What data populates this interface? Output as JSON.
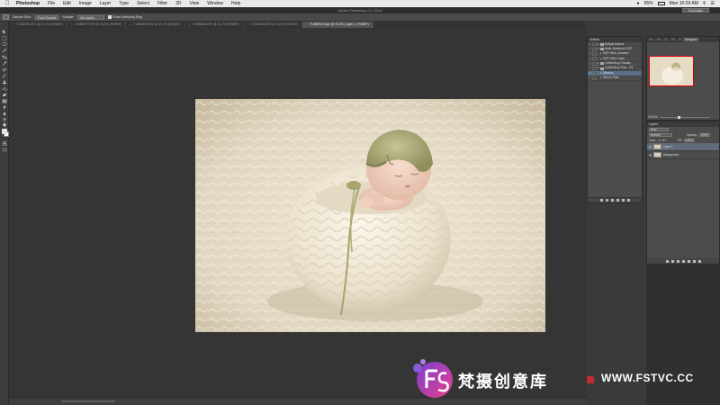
{
  "menubar": {
    "app_name": "Photoshop",
    "items": [
      "File",
      "Edit",
      "Image",
      "Layer",
      "Type",
      "Select",
      "Filter",
      "3D",
      "View",
      "Window",
      "Help"
    ],
    "battery": "95%",
    "clock": "Mon 10:29 AM"
  },
  "window": {
    "title": "Adobe Photoshop CC 2014",
    "workspace": "Essentials"
  },
  "options": {
    "sample_size_label": "Sample Size:",
    "sample_size_value": "Point Sample",
    "sample_label": "Sample:",
    "sample_value": "All Layers",
    "show_ring_label": "Show Sampling Ring"
  },
  "tabs": [
    {
      "label": "71SB0851CR2 @ 11.1% (RGB/8*)",
      "active": false
    },
    {
      "label": "71SB0877CR2 @ 33.3% (RGB/8*)",
      "active": false
    },
    {
      "label": "71SB0882CR2 @ 33.3% (RGB/8*)",
      "active": false
    },
    {
      "label": "71SB0883CR2 @ 33.3% (RGB/8*)",
      "active": false
    },
    {
      "label": "71SB0903CR2 @ 33.3% (RGB/8*)",
      "active": false
    },
    {
      "label": "71SB0910.tiwe @ 33.3% (Layer 1, RGB/8*)",
      "active": true
    }
  ],
  "actions_panel": {
    "tab": "Actions",
    "items": [
      {
        "label": "Default Actions",
        "kind": "set",
        "highlight": false
      },
      {
        "label": "Hello, Newborn! SCP",
        "kind": "set",
        "highlight": false
      },
      {
        "label": "SCP Hello, Sweeten",
        "kind": "action",
        "highlight": false
      },
      {
        "label": "SCP Hello, Haze",
        "kind": "action",
        "highlight": false
      },
      {
        "label": "CoffeeShop Powder...",
        "kind": "set",
        "highlight": false
      },
      {
        "label": "CoffeeShop Pow... S3",
        "kind": "set",
        "highlight": false
      },
      {
        "label": "Shadow",
        "kind": "action",
        "highlight": true
      },
      {
        "label": "Wet as Paint",
        "kind": "action",
        "highlight": false
      }
    ]
  },
  "navigator": {
    "tabs": [
      "His",
      "Sw",
      "Co",
      "Pa",
      "St",
      "Navigator"
    ],
    "active_tab": "Navigator",
    "zoom": "33.33%"
  },
  "layers_panel": {
    "tab": "Layers",
    "kind_filter": "Kind",
    "blend_mode": "Normal",
    "opacity_label": "Opacity:",
    "opacity": "100%",
    "lock_label": "Lock:",
    "fill_label": "Fill:",
    "fill": "100%",
    "layers": [
      {
        "name": "Layer 1",
        "selected": true
      },
      {
        "name": "Background",
        "selected": false
      }
    ]
  },
  "watermark": {
    "chinese": "梵摄创意库",
    "url": "WWW.FSTVC.CC"
  },
  "colors": {
    "accent_selection": "#5b6f8a",
    "watermark_pink": "#e8418a",
    "watermark_purple": "#7a3fd1"
  }
}
